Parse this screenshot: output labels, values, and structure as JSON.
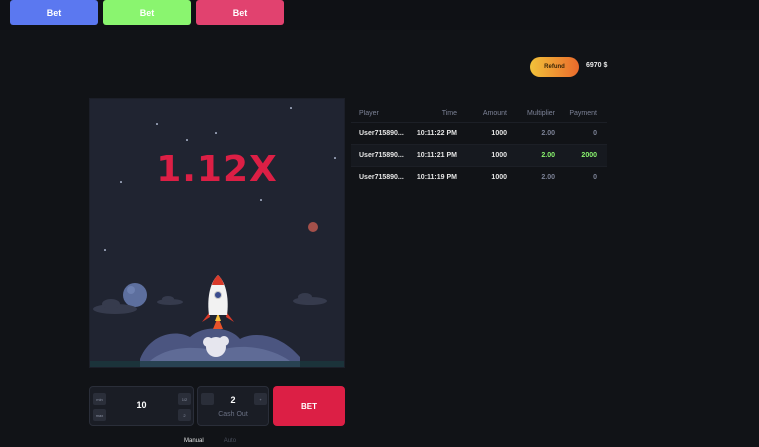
{
  "topbar": {
    "buttons": [
      {
        "label": "Bet",
        "color": "#5b78f0"
      },
      {
        "label": "Bet",
        "color": "#8af56f"
      },
      {
        "label": "Bet",
        "color": "#e1426f"
      }
    ]
  },
  "account": {
    "refund_label": "Refund",
    "balance": "6970 $"
  },
  "game": {
    "multiplier": "1.12X",
    "accent_color": "#dc1f45"
  },
  "history": {
    "headers": [
      "Player",
      "Time",
      "Amount",
      "Multiplier",
      "Payment"
    ],
    "rows": [
      {
        "player": "User715890...",
        "time": "10:11:22 PM",
        "amount": "1000",
        "multiplier": "2.00",
        "payment": "0"
      },
      {
        "player": "User715890...",
        "time": "10:11:21 PM",
        "amount": "1000",
        "multiplier": "2.00",
        "payment": "2000"
      },
      {
        "player": "User715890...",
        "time": "10:11:19 PM",
        "amount": "1000",
        "multiplier": "2.00",
        "payment": "0"
      }
    ]
  },
  "controls": {
    "bet_amount": "10",
    "amount_buttons": [
      "min",
      "max",
      "1/2",
      "2"
    ],
    "cashout_value": "2",
    "cashout_label": "Cash Out",
    "stepper_plus": "+",
    "bet_label": "BET",
    "tabs": [
      "Manual",
      "Auto"
    ]
  }
}
